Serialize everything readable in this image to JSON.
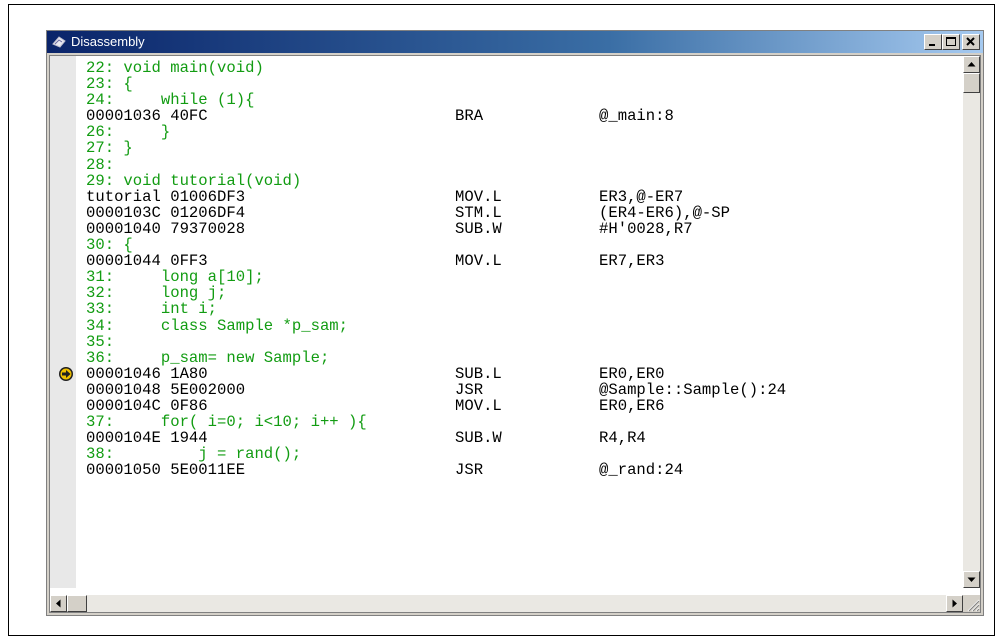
{
  "window": {
    "title": "Disassembly",
    "minimize_label": "_",
    "maximize_label": "□",
    "close_label": "×"
  },
  "lines": [
    {
      "type": "src",
      "text": "22: void main(void)"
    },
    {
      "type": "src",
      "text": "23: {"
    },
    {
      "type": "src",
      "text": "24:     while (1){"
    },
    {
      "type": "asm",
      "addr": "00001036 40FC",
      "mnem": "BRA",
      "oper": "@_main:8"
    },
    {
      "type": "src",
      "text": "26:     }"
    },
    {
      "type": "src",
      "text": "27: }"
    },
    {
      "type": "src",
      "text": "28:"
    },
    {
      "type": "src",
      "text": "29: void tutorial(void)"
    },
    {
      "type": "asm",
      "addr": "tutorial 01006DF3",
      "mnem": "MOV.L",
      "oper": "ER3,@-ER7"
    },
    {
      "type": "asm",
      "addr": "0000103C 01206DF4",
      "mnem": "STM.L",
      "oper": "(ER4-ER6),@-SP"
    },
    {
      "type": "asm",
      "addr": "00001040 79370028",
      "mnem": "SUB.W",
      "oper": "#H'0028,R7"
    },
    {
      "type": "src",
      "text": "30: {"
    },
    {
      "type": "asm",
      "addr": "00001044 0FF3",
      "mnem": "MOV.L",
      "oper": "ER7,ER3"
    },
    {
      "type": "src",
      "text": "31:     long a[10];"
    },
    {
      "type": "src",
      "text": "32:     long j;"
    },
    {
      "type": "src",
      "text": "33:     int i;"
    },
    {
      "type": "src",
      "text": "34:     class Sample *p_sam;"
    },
    {
      "type": "src",
      "text": "35:"
    },
    {
      "type": "src",
      "text": "36:     p_sam= new Sample;"
    },
    {
      "type": "asm",
      "addr": "00001046 1A80",
      "mnem": "SUB.L",
      "oper": "ER0,ER0",
      "current": true
    },
    {
      "type": "asm",
      "addr": "00001048 5E002000",
      "mnem": "JSR",
      "oper": "@Sample::Sample():24"
    },
    {
      "type": "asm",
      "addr": "0000104C 0F86",
      "mnem": "MOV.L",
      "oper": "ER0,ER6"
    },
    {
      "type": "src",
      "text": "37:     for( i=0; i<10; i++ ){"
    },
    {
      "type": "asm",
      "addr": "0000104E 1944",
      "mnem": "SUB.W",
      "oper": "R4,R4"
    },
    {
      "type": "src",
      "text": "38:         j = rand();"
    },
    {
      "type": "asm",
      "addr": "00001050 5E0011EE",
      "mnem": "JSR",
      "oper": "@_rand:24"
    }
  ],
  "colors": {
    "source": "#129c12",
    "assembly": "#000000",
    "gutter": "#e8e8e8",
    "current_arrow": "#f0c000"
  },
  "icons": {
    "title": "disassembly-window-icon",
    "current_pc": "program-counter-arrow-icon"
  }
}
